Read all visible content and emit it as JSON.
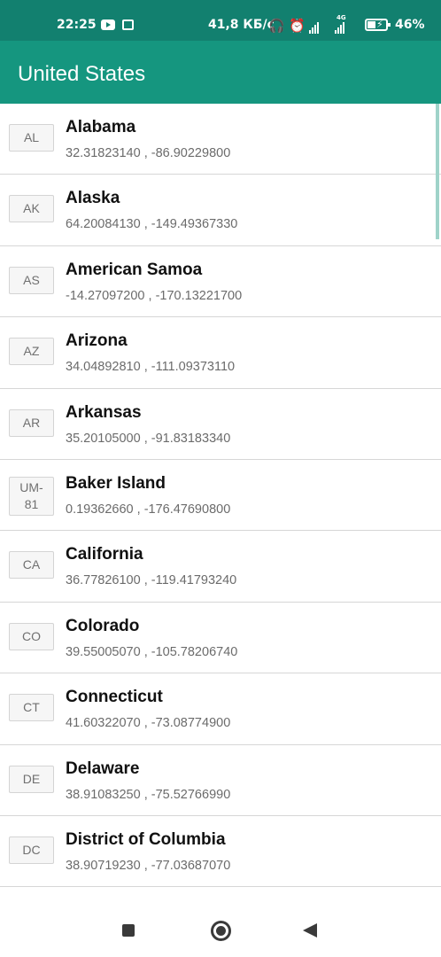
{
  "status_bar": {
    "time": "22:25",
    "network_speed": "41,8 КБ/с",
    "signal_label": "4G",
    "battery_percent": "46%",
    "icons": [
      "youtube-icon",
      "message-icon",
      "headset-icon",
      "alarm-icon",
      "signal-icon",
      "signal-4g-icon",
      "battery-charging-icon"
    ]
  },
  "app_bar": {
    "title": "United States",
    "background": "#15967f"
  },
  "states": [
    {
      "code": "AL",
      "name": "Alabama",
      "coords": "32.31823140 , -86.90229800"
    },
    {
      "code": "AK",
      "name": "Alaska",
      "coords": "64.20084130 , -149.49367330"
    },
    {
      "code": "AS",
      "name": "American Samoa",
      "coords": "-14.27097200 , -170.13221700"
    },
    {
      "code": "AZ",
      "name": "Arizona",
      "coords": "34.04892810 , -111.09373110"
    },
    {
      "code": "AR",
      "name": "Arkansas",
      "coords": "35.20105000 , -91.83183340"
    },
    {
      "code": "UM-81",
      "name": "Baker Island",
      "coords": "0.19362660 , -176.47690800"
    },
    {
      "code": "CA",
      "name": "California",
      "coords": "36.77826100 , -119.41793240"
    },
    {
      "code": "CO",
      "name": "Colorado",
      "coords": "39.55005070 , -105.78206740"
    },
    {
      "code": "CT",
      "name": "Connecticut",
      "coords": "41.60322070 , -73.08774900"
    },
    {
      "code": "DE",
      "name": "Delaware",
      "coords": "38.91083250 , -75.52766990"
    },
    {
      "code": "DC",
      "name": "District of Columbia",
      "coords": "38.90719230 , -77.03687070"
    }
  ],
  "nav_bar": {
    "icons": [
      "recent-apps-icon",
      "home-icon",
      "back-icon"
    ]
  }
}
